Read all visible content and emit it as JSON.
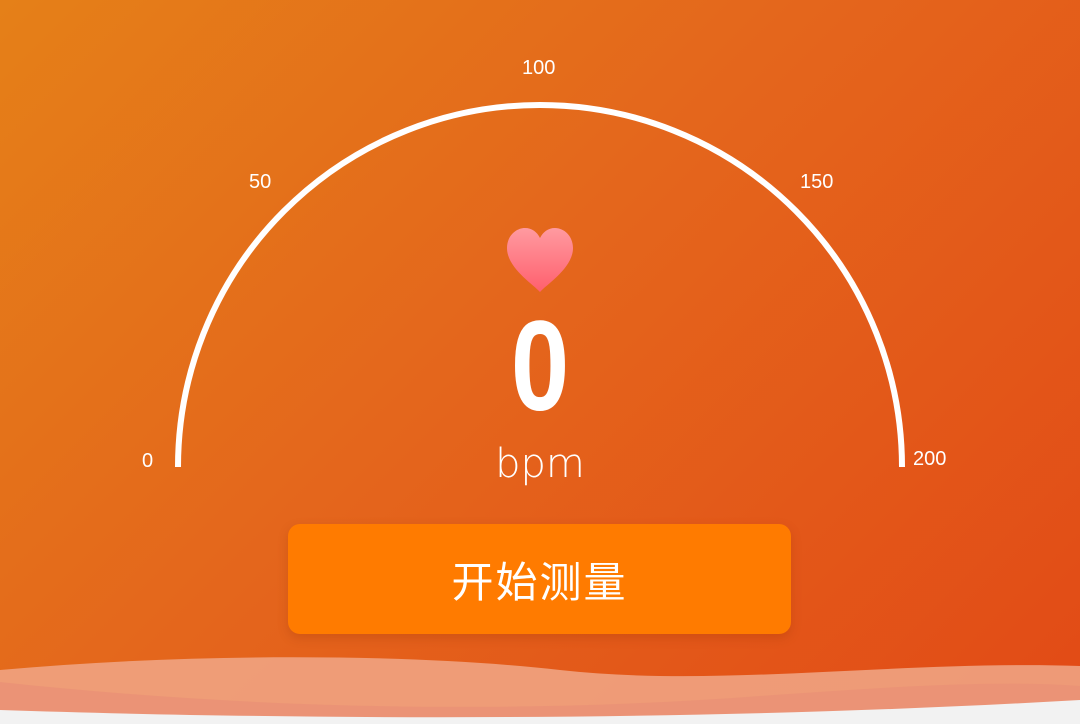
{
  "gauge": {
    "min": 0,
    "max": 200,
    "ticks": [
      "0",
      "50",
      "100",
      "150",
      "200"
    ],
    "current_value": "0",
    "unit": "bpm"
  },
  "heart_icon": "heart-icon",
  "start_button": {
    "label": "开始测量"
  },
  "colors": {
    "background_start": "#e58018",
    "background_end": "#e24a16",
    "button": "#ff7b00",
    "heart": "#ff7a85",
    "arc": "#ffffff"
  }
}
